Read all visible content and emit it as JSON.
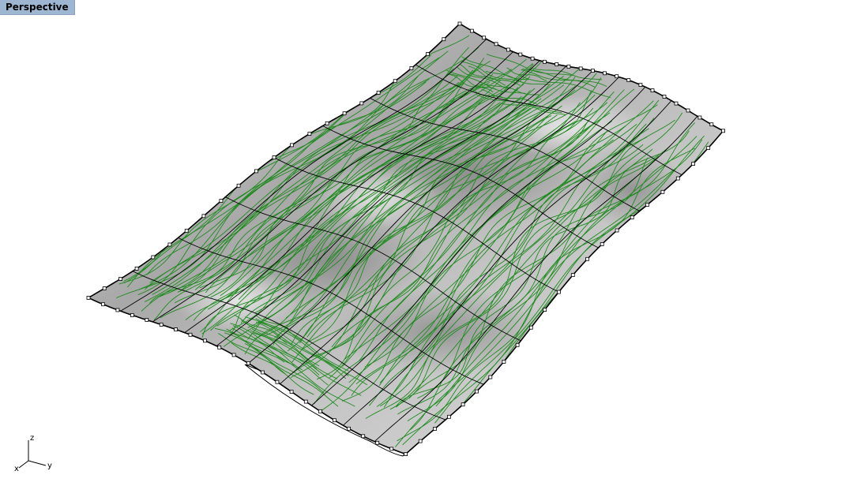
{
  "viewport": {
    "title": "Perspective",
    "axes": {
      "x": "x",
      "y": "y",
      "z": "z"
    },
    "colors": {
      "title_bg": "#9fb6d3",
      "contour": "#1f8a1f",
      "isocurve": "#000000",
      "surface_light": "#e2e2e2",
      "surface_dark": "#8a8a8a"
    }
  }
}
